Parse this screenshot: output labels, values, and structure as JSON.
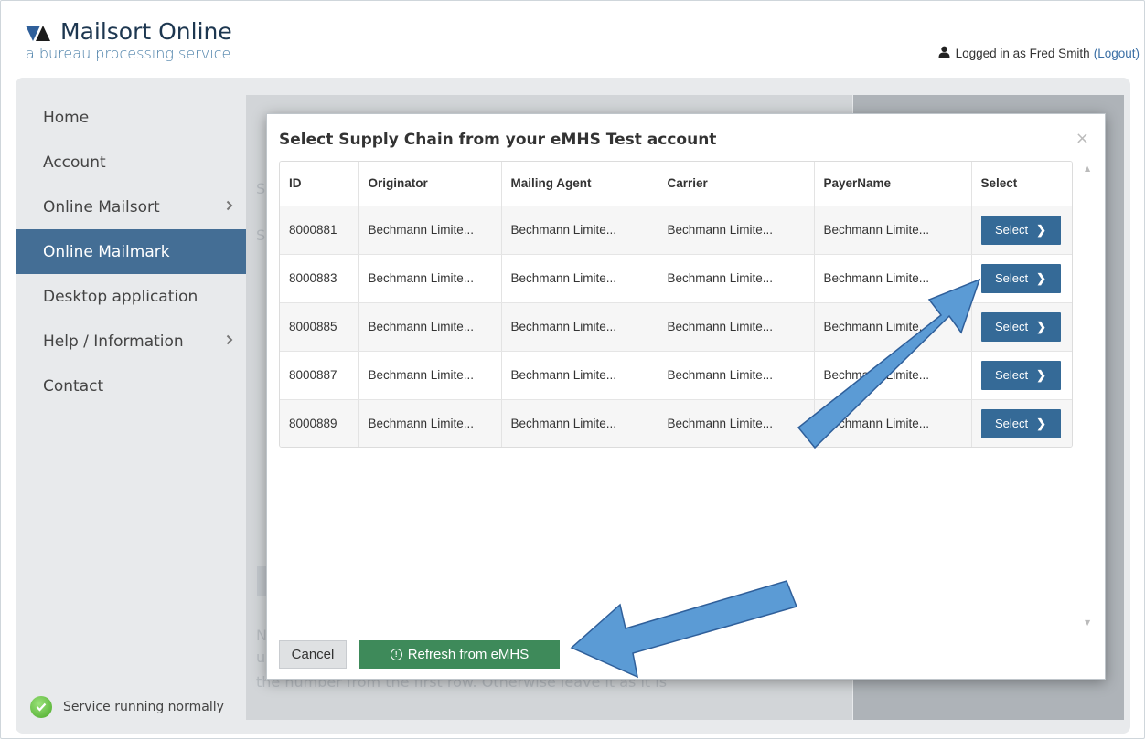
{
  "header": {
    "logo_title": "Mailsort Online",
    "logo_subtitle": "a bureau processing service",
    "logged_in_text": "Logged in as Fred Smith",
    "logout_label": "(Logout)"
  },
  "sidebar": {
    "items": [
      {
        "label": "Home",
        "chevron": false
      },
      {
        "label": "Account",
        "chevron": false
      },
      {
        "label": "Online Mailsort",
        "chevron": true
      },
      {
        "label": "Online Mailmark",
        "chevron": false,
        "active": true
      },
      {
        "label": "Desktop application",
        "chevron": false
      },
      {
        "label": "Help / Information",
        "chevron": true
      },
      {
        "label": "Contact",
        "chevron": false
      }
    ],
    "chevron_glyph": "›",
    "status_text": "Service running normally"
  },
  "background_text": {
    "frag1": "S",
    "frag2": "S",
    "frag3": "N",
    "frag4": "u",
    "bottom_line": "the number from the first row. Otherwise leave it as it is."
  },
  "modal": {
    "title": "Select Supply Chain from your eMHS Test account",
    "close_glyph": "×",
    "columns": [
      "ID",
      "Originator",
      "Mailing Agent",
      "Carrier",
      "PayerName",
      "Select"
    ],
    "rows": [
      {
        "id": "8000881",
        "originator": "Bechmann Limite...",
        "mailing_agent": "Bechmann Limite...",
        "carrier": "Bechmann Limite...",
        "payer": "Bechmann Limite...",
        "action": "Select"
      },
      {
        "id": "8000883",
        "originator": "Bechmann Limite...",
        "mailing_agent": "Bechmann Limite...",
        "carrier": "Bechmann Limite...",
        "payer": "Bechmann Limite...",
        "action": "Select"
      },
      {
        "id": "8000885",
        "originator": "Bechmann Limite...",
        "mailing_agent": "Bechmann Limite...",
        "carrier": "Bechmann Limite...",
        "payer": "Bechmann Limite...",
        "action": "Select"
      },
      {
        "id": "8000887",
        "originator": "Bechmann Limite...",
        "mailing_agent": "Bechmann Limite...",
        "carrier": "Bechmann Limite...",
        "payer": "Bechmann Limite...",
        "action": "Select"
      },
      {
        "id": "8000889",
        "originator": "Bechmann Limite...",
        "mailing_agent": "Bechmann Limite...",
        "carrier": "Bechmann Limite...",
        "payer": "Bechmann Limite...",
        "action": "Select"
      }
    ],
    "select_chevron": "❯",
    "cancel_label": "Cancel",
    "refresh_label": "Refresh from eMHS"
  },
  "colors": {
    "accent": "#446e95",
    "button": "#356a97",
    "refresh": "#3e8a5a",
    "annotation_arrow": "#5b9bd5"
  }
}
